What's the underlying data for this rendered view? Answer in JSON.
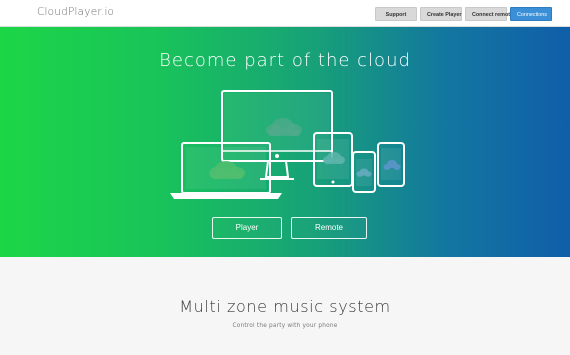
{
  "header": {
    "brand": "CloudPlayer.io",
    "nav": [
      {
        "label": "Support"
      },
      {
        "label": "Create Player"
      },
      {
        "label": "Connect remote"
      },
      {
        "label": "Connections"
      }
    ]
  },
  "hero": {
    "title": "Become part of the cloud",
    "buttons": {
      "player": "Player",
      "remote": "Remote"
    },
    "colors": {
      "gradient_start": "#1cd646",
      "gradient_end": "#0f5ea9"
    }
  },
  "section": {
    "title": "Multi zone music system",
    "subtitle": "Control the party with your phone"
  },
  "icons": [
    "devices-illustration",
    "cloud-icon"
  ]
}
